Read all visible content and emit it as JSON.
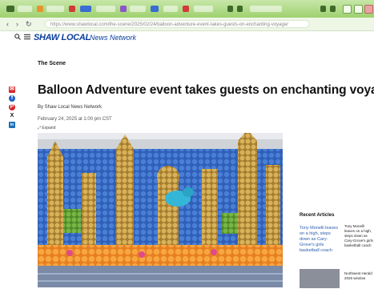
{
  "browser": {
    "url": "https://www.shawlocal.com/the-scene/2025/02/24/balloon-adventure-event-takes-guests-on-enchanting-voyage/",
    "back_glyph": "‹",
    "forward_glyph": "›",
    "reload_glyph": "↻"
  },
  "site": {
    "logo": "SHAW LOCAL",
    "network": "News Network",
    "search_icon": "search-icon",
    "menu_icon": "menu-icon",
    "brand_color": "#0a3d9c"
  },
  "share": {
    "icons": [
      "mail-icon",
      "facebook-icon",
      "pinterest-icon",
      "x-icon",
      "linkedin-icon"
    ],
    "glyphs": [
      "✉",
      "f",
      "P",
      "X",
      "in"
    ],
    "colors": [
      "#d8262a",
      "#1f5fc9",
      "#d8262a",
      "#111111",
      "#1c6fb8"
    ]
  },
  "article": {
    "section": "The Scene",
    "headline": "Balloon Adventure event takes guests on enchanting voyage",
    "byline": "By Shaw Local News Network",
    "date": "February 24, 2025 at 1:00 pm CST",
    "expand": "⤢ Expand"
  },
  "rail": {
    "title": "Recent Articles",
    "link1": "Tony Monelli leaves on a high, steps down as Cary-Grove's girls basketball coach",
    "side1": "Tony Monelli leaves on a high, steps down as Cary-Grove's girls basketball coach",
    "side2": "Northwest Herald 2025 window"
  }
}
